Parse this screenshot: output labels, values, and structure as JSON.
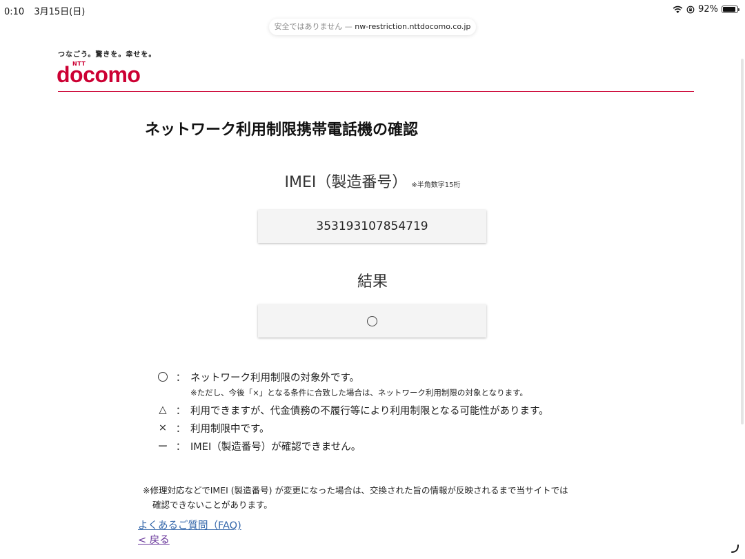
{
  "status_bar": {
    "time": "0:10",
    "date": "3月15日(日)",
    "battery": "92%",
    "battery_level": 0.92
  },
  "url_bar": {
    "security_warning": "安全ではありません",
    "separator": "—",
    "host": "nw-restriction.nttdocomo.co.jp"
  },
  "header": {
    "tagline": "つなごう。驚きを。幸せを。",
    "logo_small": "NTT",
    "logo_text": "docomo",
    "brand_color": "#cc0033"
  },
  "page": {
    "title": "ネットワーク利用制限携帯電話機の確認"
  },
  "imei": {
    "label": "IMEI（製造番号）",
    "note": "※半角数字15桁",
    "value": "353193107854719"
  },
  "result": {
    "label": "結果",
    "symbol": "circle"
  },
  "legend": [
    {
      "symbol": "○",
      "colon": "：",
      "text": "ネットワーク利用制限の対象外です。"
    },
    {
      "sub": "※ただし、今後「×」となる条件に合致した場合は、ネットワーク利用制限の対象となります。"
    },
    {
      "symbol": "△",
      "colon": "：",
      "text": "利用できますが、代金債務の不履行等により利用制限となる可能性があります。"
    },
    {
      "symbol": "×",
      "colon": "：",
      "text": "利用制限中です。"
    },
    {
      "symbol": "ー",
      "colon": "：",
      "text": "IMEI（製造番号）が確認できません。"
    }
  ],
  "footnote": {
    "line1": "※修理対応などでIMEI (製造番号) が変更になった場合は、交換された旨の情報が反映されるまで当サイトでは",
    "line2": "確認できないことがあります。"
  },
  "links": {
    "faq": "よくあるご質問（FAQ)",
    "back": "< 戻る"
  }
}
